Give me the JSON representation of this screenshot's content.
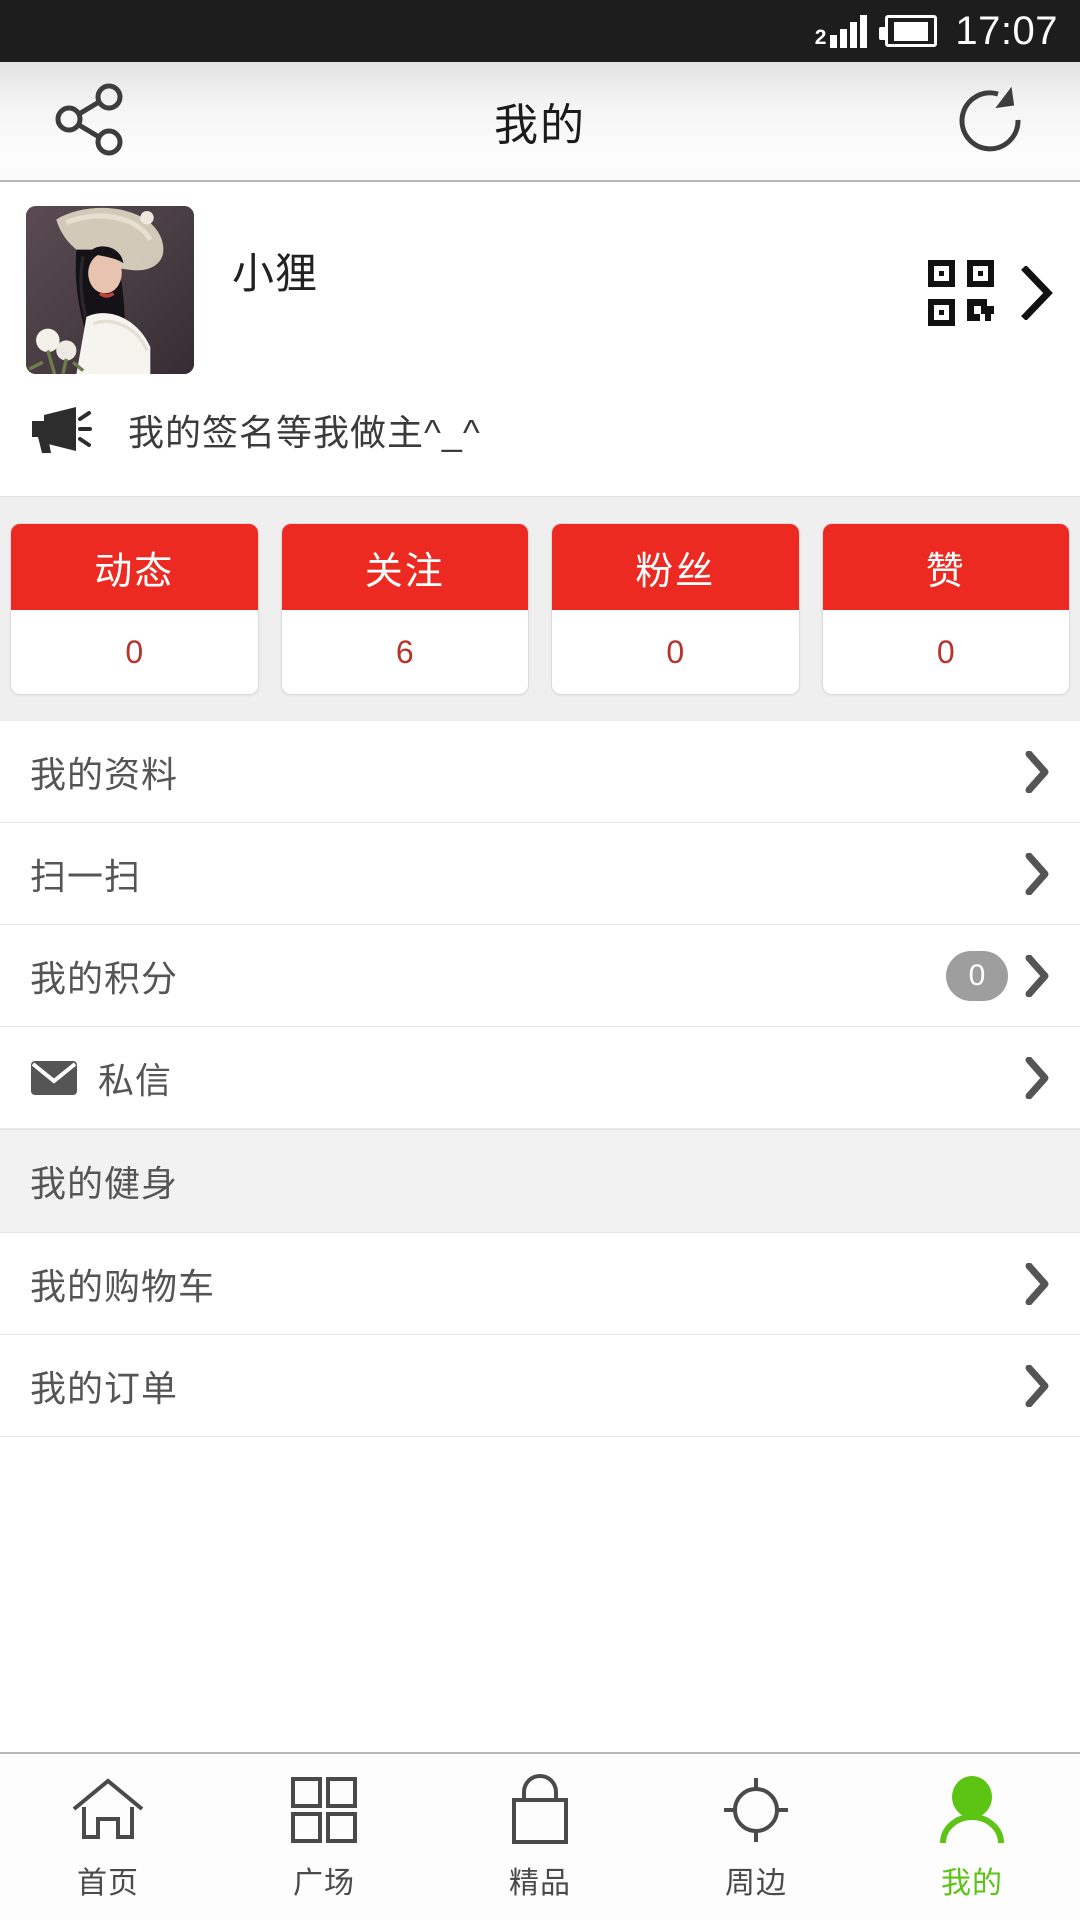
{
  "status_bar": {
    "signal_label": "2",
    "time": "17:07",
    "icons": [
      "signal-icon",
      "battery-icon"
    ]
  },
  "header": {
    "title": "我的",
    "share_icon": "share-icon",
    "refresh_icon": "refresh-icon"
  },
  "profile": {
    "username": "小狸",
    "avatar_alt": "user-avatar-photo",
    "qr_icon": "qr-code-icon",
    "chevron_icon": "chevron-right-icon",
    "signature_icon": "megaphone-icon",
    "signature": "我的签名等我做主^_^"
  },
  "stats": [
    {
      "label": "动态",
      "value": "0"
    },
    {
      "label": "关注",
      "value": "6"
    },
    {
      "label": "粉丝",
      "value": "0"
    },
    {
      "label": "赞",
      "value": "0"
    }
  ],
  "menu": [
    {
      "label": "我的资料",
      "type": "row",
      "icon": null,
      "badge": null,
      "chevron": true
    },
    {
      "label": "扫一扫",
      "type": "row",
      "icon": null,
      "badge": null,
      "chevron": true
    },
    {
      "label": "我的积分",
      "type": "row",
      "icon": null,
      "badge": "0",
      "chevron": true
    },
    {
      "label": "私信",
      "type": "row",
      "icon": "envelope-icon",
      "badge": null,
      "chevron": true
    },
    {
      "label": "我的健身",
      "type": "section",
      "icon": null,
      "badge": null,
      "chevron": false
    },
    {
      "label": "我的购物车",
      "type": "row",
      "icon": null,
      "badge": null,
      "chevron": true
    },
    {
      "label": "我的订单",
      "type": "row",
      "icon": null,
      "badge": null,
      "chevron": true
    }
  ],
  "tabbar": {
    "items": [
      {
        "label": "首页",
        "icon": "home-icon",
        "active": false
      },
      {
        "label": "广场",
        "icon": "grid-icon",
        "active": false
      },
      {
        "label": "精品",
        "icon": "shopping-bag-icon",
        "active": false
      },
      {
        "label": "周边",
        "icon": "location-crosshair-icon",
        "active": false
      },
      {
        "label": "我的",
        "icon": "person-icon",
        "active": true
      }
    ]
  },
  "colors": {
    "accent_red": "#ed2a22",
    "stat_value_red": "#b8332c",
    "active_green": "#5cc413",
    "status_bar_bg": "#1d1d1d",
    "band_gray": "#efefef",
    "text_gray": "#555555"
  }
}
